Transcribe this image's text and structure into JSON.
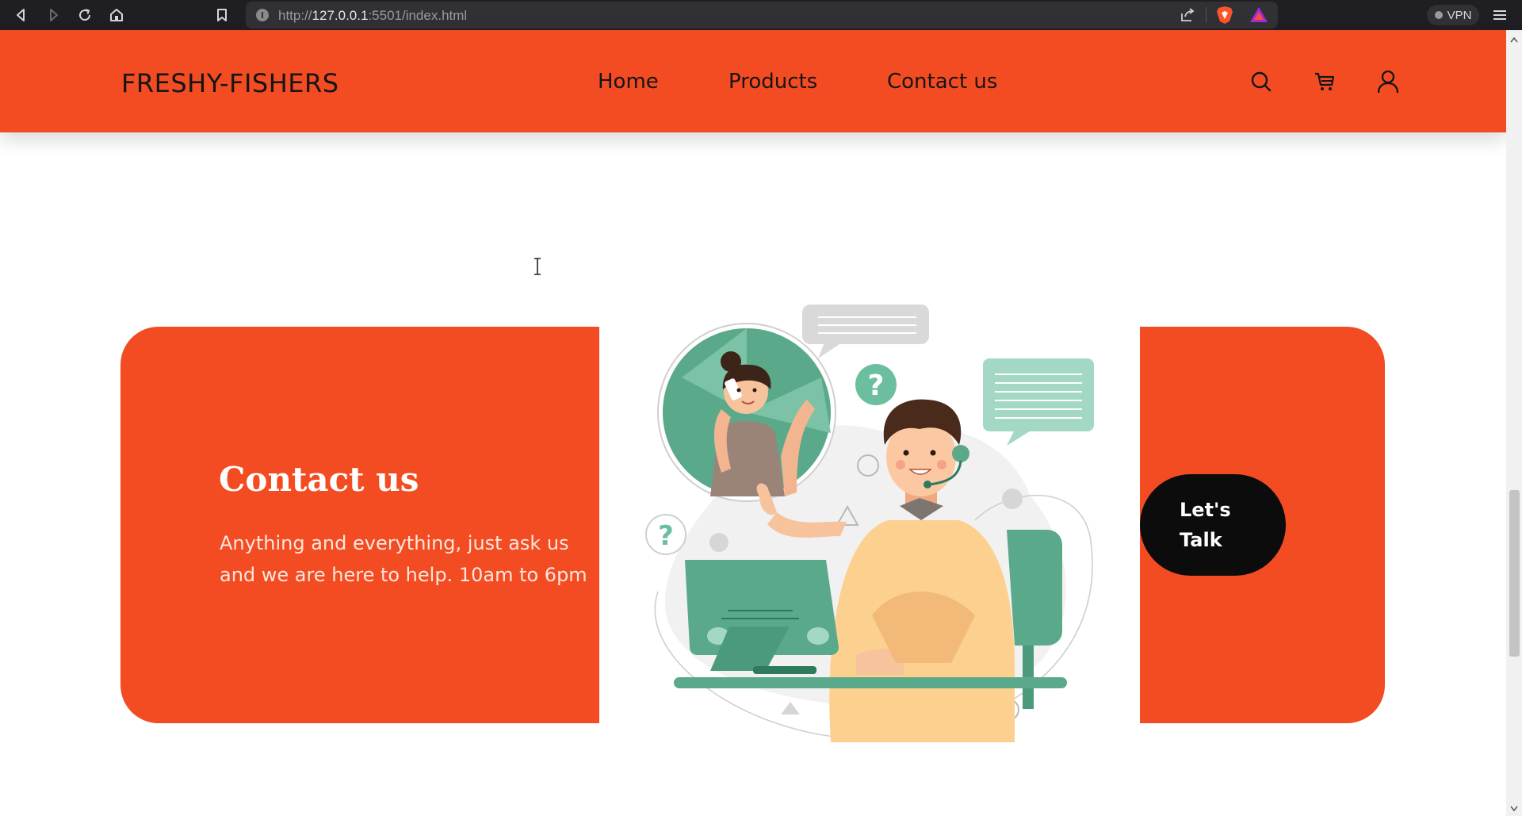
{
  "browser": {
    "url_prefix": "http://",
    "url_host": "127.0.0.1",
    "url_rest": ":5501/index.html",
    "vpn_label": "VPN",
    "icons": [
      "back-icon",
      "forward-icon",
      "reload-icon",
      "home-icon",
      "bookmark-icon",
      "site-info-icon",
      "share-icon",
      "brave-shield-icon",
      "brave-rewards-icon",
      "menu-icon"
    ]
  },
  "header": {
    "brand": "FRESHY-FISHERS",
    "menu": [
      {
        "label": "Home"
      },
      {
        "label": "Products"
      },
      {
        "label": "Contact us"
      }
    ],
    "icons": [
      "search-icon",
      "cart-icon",
      "user-icon"
    ]
  },
  "contact": {
    "title": "Contact us",
    "description": "Anything and everything, just ask us and we are here to help. 10am to 6pm",
    "cta_label": "Let's Talk"
  },
  "colors": {
    "brand_orange": "#f34c22",
    "cta_black": "#0c0c0c",
    "illustration_green": "#5aa98a",
    "illustration_mint": "#a3d9c4"
  }
}
